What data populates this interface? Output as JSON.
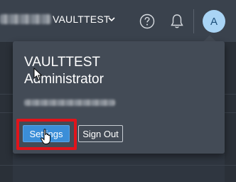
{
  "header": {
    "org_name": "VAULTTEST",
    "avatar_initial": "A"
  },
  "user_menu": {
    "user_name": "VAULTTEST",
    "role": "Administrator",
    "settings_label": "Settings",
    "signout_label": "Sign Out"
  },
  "colors": {
    "primary": "#3b8ed8",
    "highlight": "#e0141b",
    "avatar_bg": "#a9d4f5"
  },
  "icons": [
    "chevron-down-icon",
    "help-icon",
    "bell-icon",
    "cursor-arrow-icon",
    "cursor-hand-icon"
  ]
}
